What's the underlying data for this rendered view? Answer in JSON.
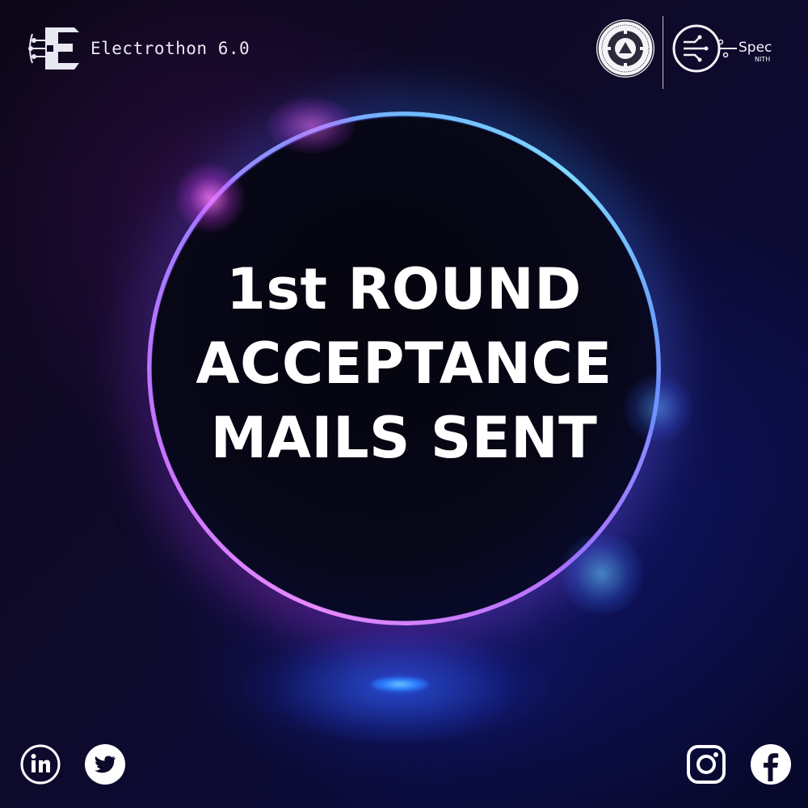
{
  "brand": {
    "name": "Electrothon 6.0",
    "logo_icon": "electrothon-e-circuit-logo"
  },
  "partners": [
    {
      "icon": "nith-seal-logo"
    },
    {
      "icon": "spec-nith-circuit-logo",
      "text": "Spec",
      "subtext": "NITH"
    }
  ],
  "headline": {
    "line1": "1st ROUND",
    "line2": "ACCEPTANCE",
    "line3": "MAILS SENT"
  },
  "social_left": [
    {
      "icon": "linkedin-icon"
    },
    {
      "icon": "twitter-icon"
    }
  ],
  "social_right": [
    {
      "icon": "instagram-icon"
    },
    {
      "icon": "facebook-icon"
    }
  ],
  "colors": {
    "background": "#0a0722",
    "ring_pink": "#e68bff",
    "ring_blue": "#7fd9ff",
    "text": "#ffffff"
  }
}
